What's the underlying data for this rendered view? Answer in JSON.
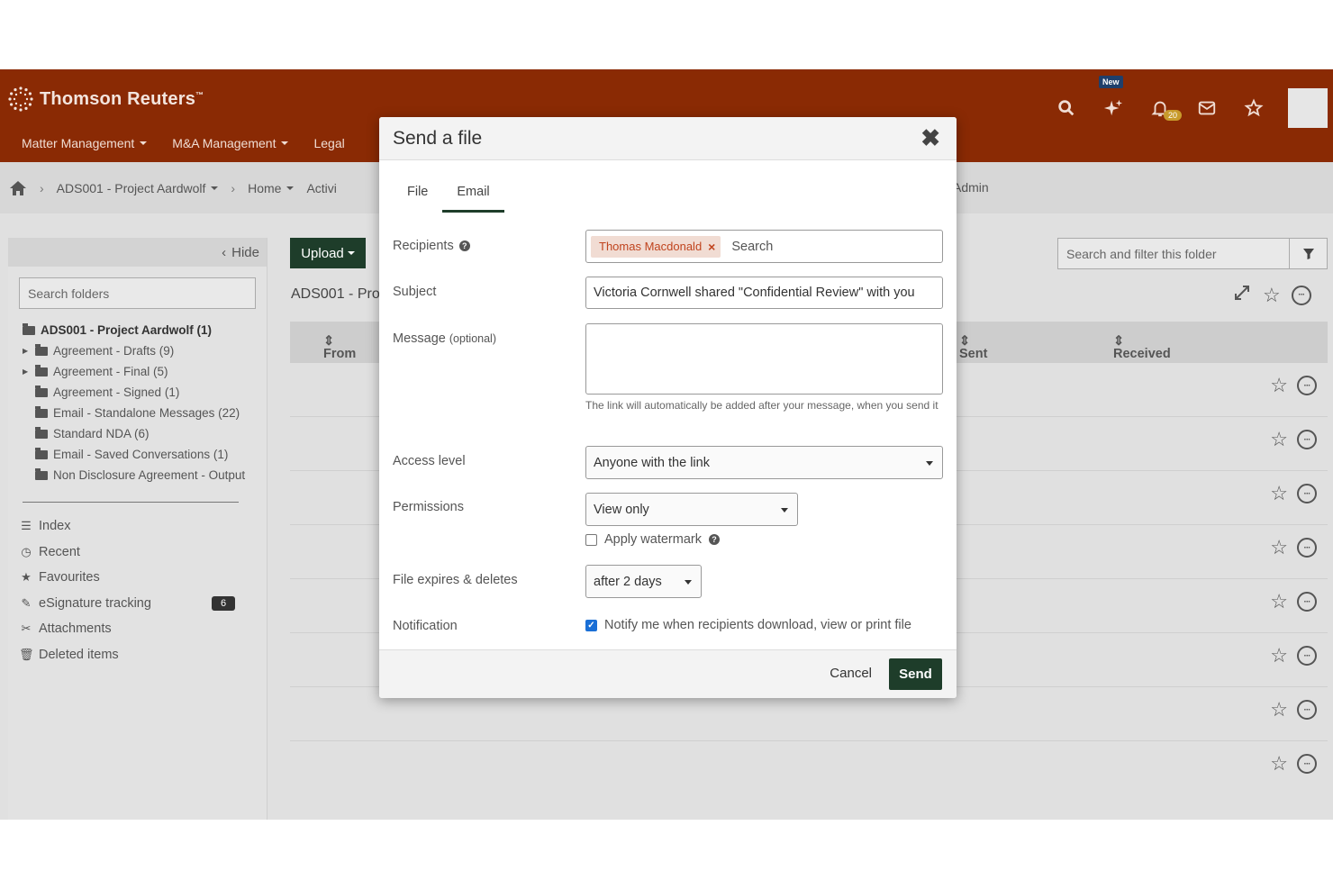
{
  "brand": {
    "name": "Thomson Reuters",
    "tm": "™",
    "color": "#8a2a04"
  },
  "header": {
    "nav": [
      "Matter Management",
      "M&A Management",
      "Legal"
    ],
    "new_badge": "New",
    "notification_count": "20"
  },
  "breadcrumb": {
    "project": "ADS001 - Project Aardwolf",
    "home": "Home",
    "activity": "Activi",
    "admin": "Admin"
  },
  "sidebar": {
    "hide_label": "Hide",
    "search_placeholder": "Search folders",
    "tree": {
      "root": "ADS001 - Project Aardwolf (1)",
      "items": [
        {
          "label": "Agreement - Drafts (9)",
          "expandable": true
        },
        {
          "label": "Agreement - Final (5)",
          "expandable": true
        },
        {
          "label": "Agreement - Signed (1)",
          "expandable": false
        },
        {
          "label": "Email - Standalone Messages (22)",
          "expandable": false
        },
        {
          "label": "Standard NDA (6)",
          "expandable": false
        },
        {
          "label": "Email - Saved Conversations (1)",
          "expandable": false
        },
        {
          "label": "Non Disclosure Agreement - Output",
          "expandable": false
        }
      ]
    },
    "links": [
      {
        "label": "Index",
        "icon": "index-icon"
      },
      {
        "label": "Recent",
        "icon": "clock-icon"
      },
      {
        "label": "Favourites",
        "icon": "star-icon"
      },
      {
        "label": "eSignature tracking",
        "icon": "edit-icon",
        "badge": "6"
      },
      {
        "label": "Attachments",
        "icon": "paperclip-icon"
      },
      {
        "label": "Deleted items",
        "icon": "trash-icon"
      }
    ]
  },
  "main": {
    "upload_label": "Upload",
    "folder_title": "ADS001 - Pro",
    "filter_placeholder": "Search and filter this folder",
    "columns": {
      "from": "From",
      "sent": "Sent",
      "received": "Received"
    },
    "row_count": 8
  },
  "modal": {
    "title": "Send a file",
    "tabs": [
      "File",
      "Email"
    ],
    "active_tab": "Email",
    "recipients_label": "Recipients",
    "recipient_chip": "Thomas Macdonald",
    "recipients_search_placeholder": "Search",
    "subject_label": "Subject",
    "subject_value": "Victoria Cornwell shared \"Confidential Review\" with you",
    "message_label": "Message",
    "message_optional": "(optional)",
    "message_value": "",
    "message_hint": "The link will automatically be added after your message, when you send it",
    "access_label": "Access level",
    "access_value": "Anyone with the link",
    "permissions_label": "Permissions",
    "permissions_value": "View only",
    "watermark_label": "Apply watermark",
    "watermark_checked": false,
    "expires_label": "File expires & deletes",
    "expires_value": "after 2 days",
    "notification_label": "Notification",
    "notification_text": "Notify me when recipients download, view or print file",
    "notification_checked": true,
    "cancel_label": "Cancel",
    "send_label": "Send"
  }
}
